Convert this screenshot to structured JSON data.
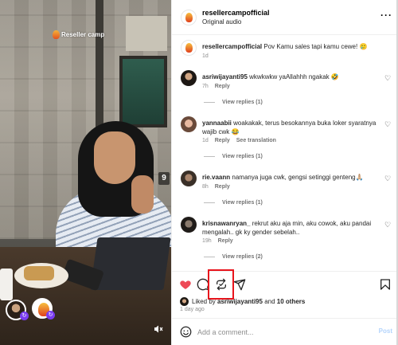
{
  "video": {
    "watermark": "Reseller camp",
    "side_number": "9",
    "mute_icon": "speaker-mute-icon"
  },
  "header": {
    "username": "resellercampofficial",
    "audio": "Original audio",
    "more_icon": "more-horizontal-icon"
  },
  "caption": {
    "username": "resellercampofficial",
    "text": "Pov Kamu sales tapi kamu cewe! 🥲",
    "time": "1d"
  },
  "comments": [
    {
      "username": "asriwijayanti95",
      "text": "wkwkwkw yaAllahhh ngakak 🤣",
      "time": "7h",
      "reply": "Reply",
      "translate": "",
      "view_replies": "View replies (1)"
    },
    {
      "username": "yannaabii",
      "text": "woakakak, terus besokannya buka loker syaratnya wajib cwk 😂",
      "time": "1d",
      "reply": "Reply",
      "translate": "See translation",
      "view_replies": "View replies (1)"
    },
    {
      "username": "rie.vaann",
      "text": "namanya juga cwk, gengsi setinggi genteng🙏🏼",
      "time": "8h",
      "reply": "Reply",
      "translate": "",
      "view_replies": "View replies (1)"
    },
    {
      "username": "krisnawanryan_",
      "text": "rekrut aku aja min, aku cowok, aku pandai mengalah.. gk ky gender sebelah..",
      "time": "19h",
      "reply": "Reply",
      "translate": "",
      "view_replies": "View replies (2)"
    }
  ],
  "actions": {
    "like_icon": "heart-filled-icon",
    "comment_icon": "comment-icon",
    "repost_icon": "repost-icon",
    "share_icon": "share-icon",
    "save_icon": "bookmark-icon",
    "like_color": "#ed4956",
    "highlight_color": "#e8141c"
  },
  "likes": {
    "prefix": "Liked by",
    "user": "asriwijayanti95",
    "joiner": "and",
    "others": "10 others"
  },
  "timeago": "1 day ago",
  "add_comment": {
    "placeholder": "Add a comment...",
    "post_label": "Post"
  }
}
